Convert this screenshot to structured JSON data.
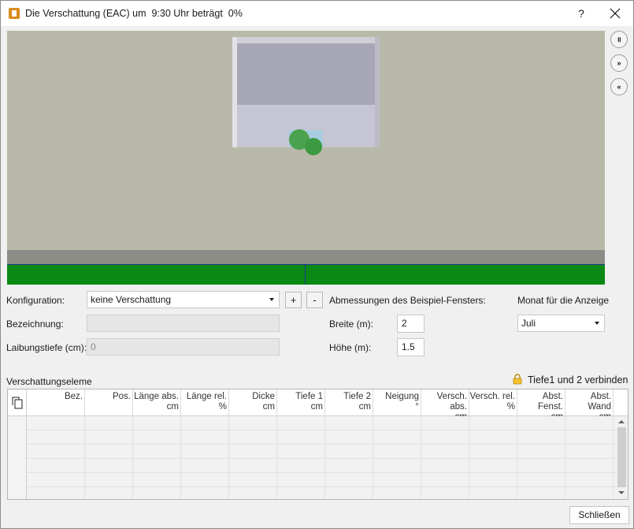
{
  "window": {
    "title": "Die Verschattung (EAC) um  9:30 Uhr beträgt  0%",
    "help_label": "?"
  },
  "playback": {
    "pause_label": "॥",
    "forward_label": "»",
    "back_label": "«"
  },
  "config": {
    "konfiguration_label": "Konfiguration:",
    "konfiguration_value": "keine Verschattung",
    "add_label": "+",
    "remove_label": "-",
    "bezeichnung_label": "Bezeichnung:",
    "bezeichnung_value": "",
    "laibungstiefe_label": "Laibungstiefe (cm):",
    "laibungstiefe_value": "0"
  },
  "window_dims": {
    "heading": "Abmessungen des Beispiel-Fensters:",
    "breite_label": "Breite (m):",
    "breite_value": "2",
    "hoehe_label": "Höhe (m):",
    "hoehe_value": "1.5"
  },
  "month": {
    "label": "Monat für die Anzeige",
    "value": "Juli"
  },
  "elements": {
    "section_label": "Verschattungseleme",
    "link_label": "Tiefe1 und 2 verbinden",
    "columns": [
      {
        "line1": "Bez.",
        "line2": ""
      },
      {
        "line1": "Pos.",
        "line2": ""
      },
      {
        "line1": "Länge abs.",
        "line2": "cm"
      },
      {
        "line1": "Länge rel.",
        "line2": "%"
      },
      {
        "line1": "Dicke",
        "line2": "cm"
      },
      {
        "line1": "Tiefe 1",
        "line2": "cm"
      },
      {
        "line1": "Tiefe 2",
        "line2": "cm"
      },
      {
        "line1": "Neigung",
        "line2": "°"
      },
      {
        "line1": "Versch. abs.",
        "line2": "cm"
      },
      {
        "line1": "Versch. rel.",
        "line2": "%"
      },
      {
        "line1": "Abst. Fenst.",
        "line2": "cm"
      },
      {
        "line1": "Abst. Wand",
        "line2": "cm"
      }
    ]
  },
  "footer": {
    "close_label": "Schließen"
  },
  "colors": {
    "grass": "#0a8a14",
    "wall": "#b9b9a9",
    "accent_icon": "#d98c1f"
  }
}
